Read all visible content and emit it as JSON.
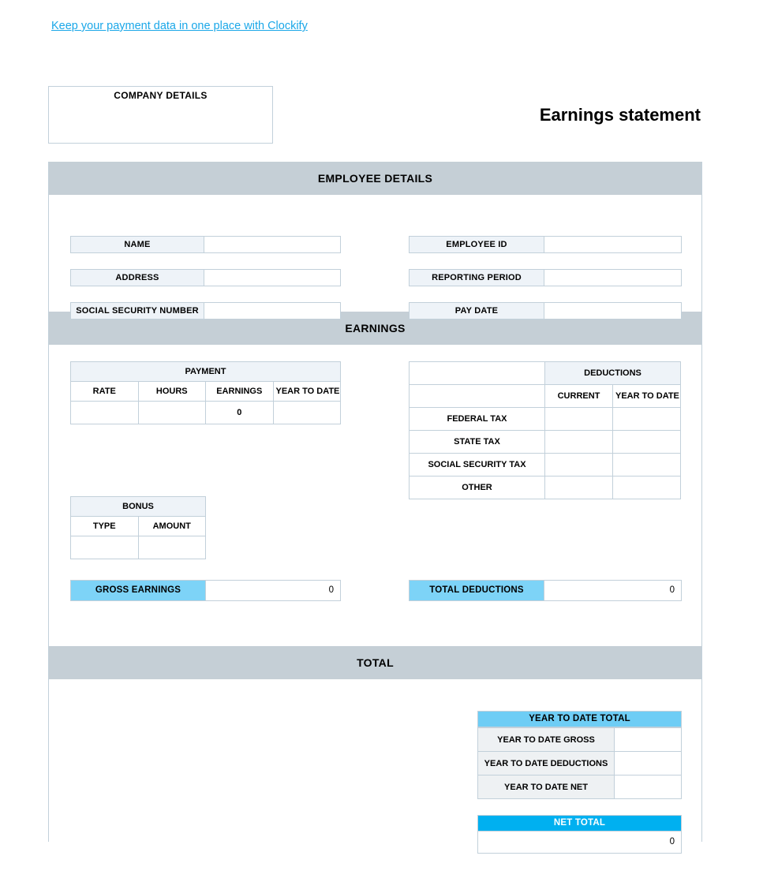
{
  "promo": {
    "link_text": "Keep your payment data in one place with Clockify",
    "link_color": "#1aa7e8"
  },
  "company_box": {
    "title": "COMPANY DETAILS"
  },
  "document": {
    "title": "Earnings statement"
  },
  "colors": {
    "band": "#c5cfd6",
    "label_fill": "#eef3f8",
    "border": "#c2d0da",
    "highlight_light": "#7dd3f7",
    "highlight_strong": "#00b0f0",
    "ytd_head": "#6ecdf5"
  },
  "employee_details": {
    "section_title": "EMPLOYEE DETAILS",
    "left_fields": [
      {
        "label": "NAME",
        "value": ""
      },
      {
        "label": "ADDRESS",
        "value": ""
      },
      {
        "label": "SOCIAL SECURITY NUMBER",
        "value": ""
      }
    ],
    "right_fields": [
      {
        "label": "EMPLOYEE ID",
        "value": ""
      },
      {
        "label": "REPORTING PERIOD",
        "value": ""
      },
      {
        "label": "PAY DATE",
        "value": ""
      }
    ]
  },
  "earnings": {
    "section_title": "EARNINGS",
    "payment_table": {
      "caption": "PAYMENT",
      "columns": [
        "RATE",
        "HOURS",
        "EARNINGS",
        "YEAR TO DATE"
      ],
      "rows": [
        {
          "rate": "",
          "hours": "",
          "earnings": "0",
          "year_to_date": ""
        }
      ]
    },
    "bonus_table": {
      "caption": "BONUS",
      "columns": [
        "TYPE",
        "AMOUNT"
      ],
      "rows": [
        {
          "type": "",
          "amount": ""
        }
      ]
    },
    "deductions_table": {
      "caption": "DEDUCTIONS",
      "columns": [
        "CURRENT",
        "YEAR TO DATE"
      ],
      "rows": [
        {
          "label": "FEDERAL TAX",
          "current": "",
          "year_to_date": ""
        },
        {
          "label": "STATE TAX",
          "current": "",
          "year_to_date": ""
        },
        {
          "label": "SOCIAL SECURITY TAX",
          "current": "",
          "year_to_date": ""
        },
        {
          "label": "OTHER",
          "current": "",
          "year_to_date": ""
        }
      ]
    },
    "gross_earnings": {
      "label": "GROSS EARNINGS",
      "value": "0"
    },
    "total_deductions": {
      "label": "TOTAL DEDUCTIONS",
      "value": "0"
    }
  },
  "total": {
    "section_title": "TOTAL",
    "ytd_total": {
      "caption": "YEAR TO DATE TOTAL",
      "rows": [
        {
          "label": "YEAR TO DATE GROSS",
          "value": ""
        },
        {
          "label": "YEAR TO DATE DEDUCTIONS",
          "value": ""
        },
        {
          "label": "YEAR TO DATE NET",
          "value": ""
        }
      ]
    },
    "net_total": {
      "caption": "NET TOTAL",
      "value": "0"
    }
  }
}
